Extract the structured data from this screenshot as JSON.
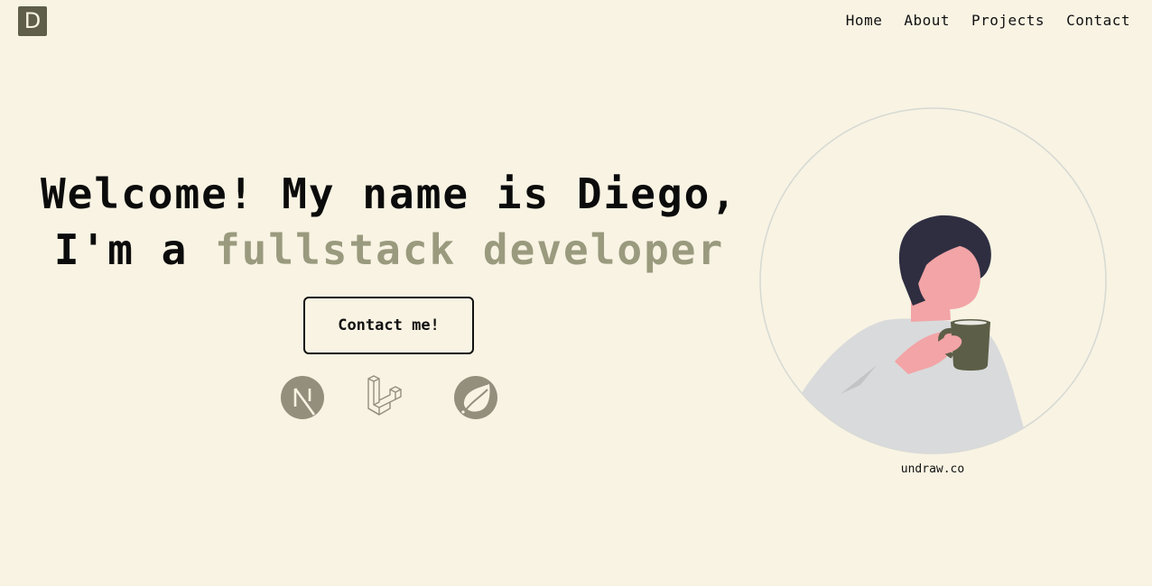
{
  "logo": {
    "letter": "D"
  },
  "nav": {
    "items": [
      "Home",
      "About",
      "Projects",
      "Contact"
    ]
  },
  "hero": {
    "line1": "Welcome! My name is Diego,",
    "line2_prefix": "I'm a ",
    "line2_accent": "fullstack developer",
    "contact_label": "Contact me!"
  },
  "tech_icons": [
    "nextjs-icon",
    "laravel-icon",
    "spring-icon"
  ],
  "illustration": {
    "credit": "undraw.co"
  },
  "colors": {
    "background": "#f8f3e3",
    "accent": "#9a9a7e",
    "logo_bg": "#5e5e4a",
    "icon_color": "#948e7c",
    "mug": "#5d5e47",
    "hair": "#2f2e41",
    "skin": "#f2a4a6",
    "shirt": "#d9dadb"
  }
}
